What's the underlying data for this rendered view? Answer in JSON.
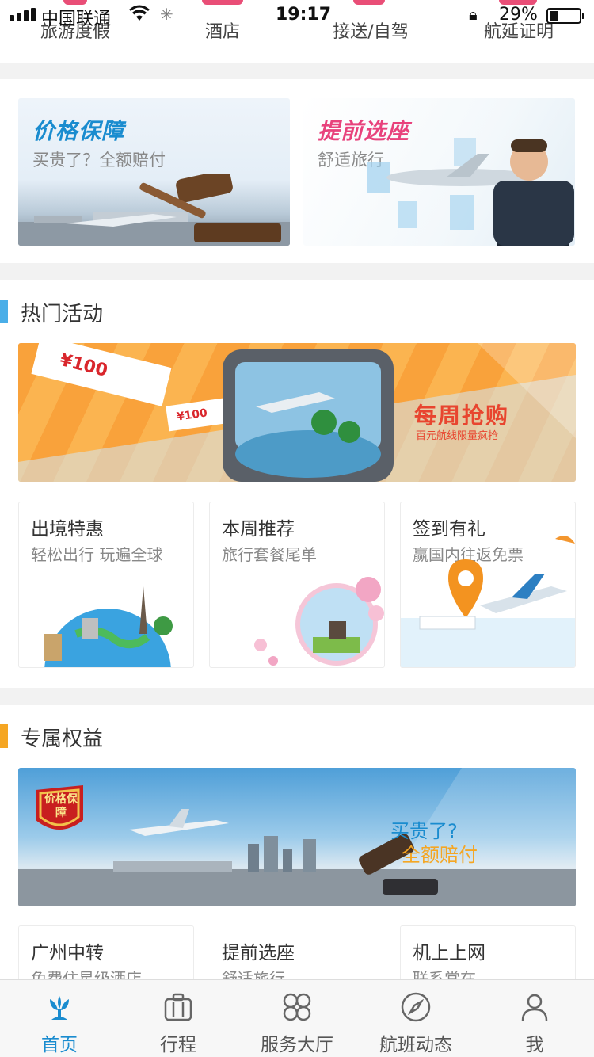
{
  "status_bar": {
    "carrier": "中国联通",
    "time": "19:17",
    "battery": "29%"
  },
  "top_nav": {
    "items": [
      "旅游度假",
      "酒店",
      "接送/自驾",
      "航延证明"
    ]
  },
  "promos": [
    {
      "title": "价格保障",
      "subtitle": "买贵了？全额赔付",
      "color": "#1a8ccf"
    },
    {
      "title": "提前选座",
      "subtitle": "舒适旅行",
      "color": "#e8427c"
    }
  ],
  "hot_activities": {
    "title": "热门活动",
    "accent": "#4aaee8",
    "banner": {
      "title": "每周抢购",
      "subtitle": "百元航线限量疯抢",
      "ticket_price": "¥100",
      "ticket_price_small": "¥100"
    },
    "tiles": [
      {
        "title": "出境特惠",
        "subtitle": "轻松出行 玩遍全球"
      },
      {
        "title": "本周推荐",
        "subtitle": "旅行套餐尾单"
      },
      {
        "title": "签到有礼",
        "subtitle": "赢国内往返免票"
      }
    ]
  },
  "exclusive": {
    "title": "专属权益",
    "accent": "#f5a623",
    "banner": {
      "badge": "价格保障",
      "line1": "买贵了?",
      "line2": "全额赔付"
    },
    "tiles": [
      {
        "title": "广州中转",
        "subtitle": "免费住星级酒店"
      },
      {
        "title": "提前选座",
        "subtitle": "舒适旅行"
      },
      {
        "title": "机上上网",
        "subtitle": "联系常在"
      }
    ]
  },
  "tab_bar": {
    "active_color": "#1a8ccf",
    "items": [
      "首页",
      "行程",
      "服务大厅",
      "航班动态",
      "我"
    ]
  }
}
